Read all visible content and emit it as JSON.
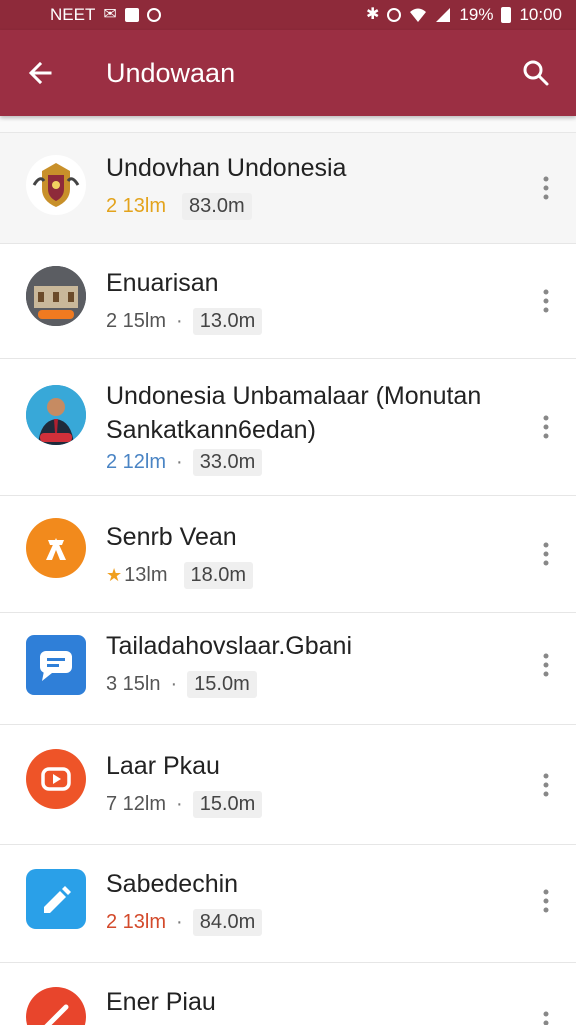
{
  "status_bar": {
    "carrier": "NEET",
    "battery": "19%",
    "time": "10:00"
  },
  "app_bar": {
    "title": "Undowaan"
  },
  "items": [
    {
      "title": "Undovhan Undonesia",
      "count": "2 13lm",
      "size": "83.0m",
      "avatar": "crest-emblem"
    },
    {
      "title": "Enuarisan",
      "count": "2 15lm",
      "size": "13.0m",
      "avatar": "building-photo"
    },
    {
      "title": "Undonesia Unbamalaar (Monutan",
      "title_line2": "Sankatkann6edan)",
      "count": "2 12lm",
      "size": "33.0m",
      "avatar": "person-photo"
    },
    {
      "title": "Senrb Vean",
      "count": "13lm",
      "size": "18.0m",
      "avatar": "orange-x-icon"
    },
    {
      "title": "Tailadahovslaar.Gbani",
      "count": "3 15ln",
      "size": "15.0m",
      "avatar": "chat-bubble-icon"
    },
    {
      "title": "Laar Pkau",
      "count": "7 12lm",
      "size": "15.0m",
      "avatar": "play-icon"
    },
    {
      "title": "Sabedechin",
      "count": "2 13lm",
      "size": "84.0m",
      "avatar": "pencil-icon"
    },
    {
      "title": "Ener Piau",
      "avatar": "no-entry-icon"
    }
  ],
  "colors": {
    "status_bar": "#8e2a3a",
    "app_bar": "#9b2f43"
  }
}
